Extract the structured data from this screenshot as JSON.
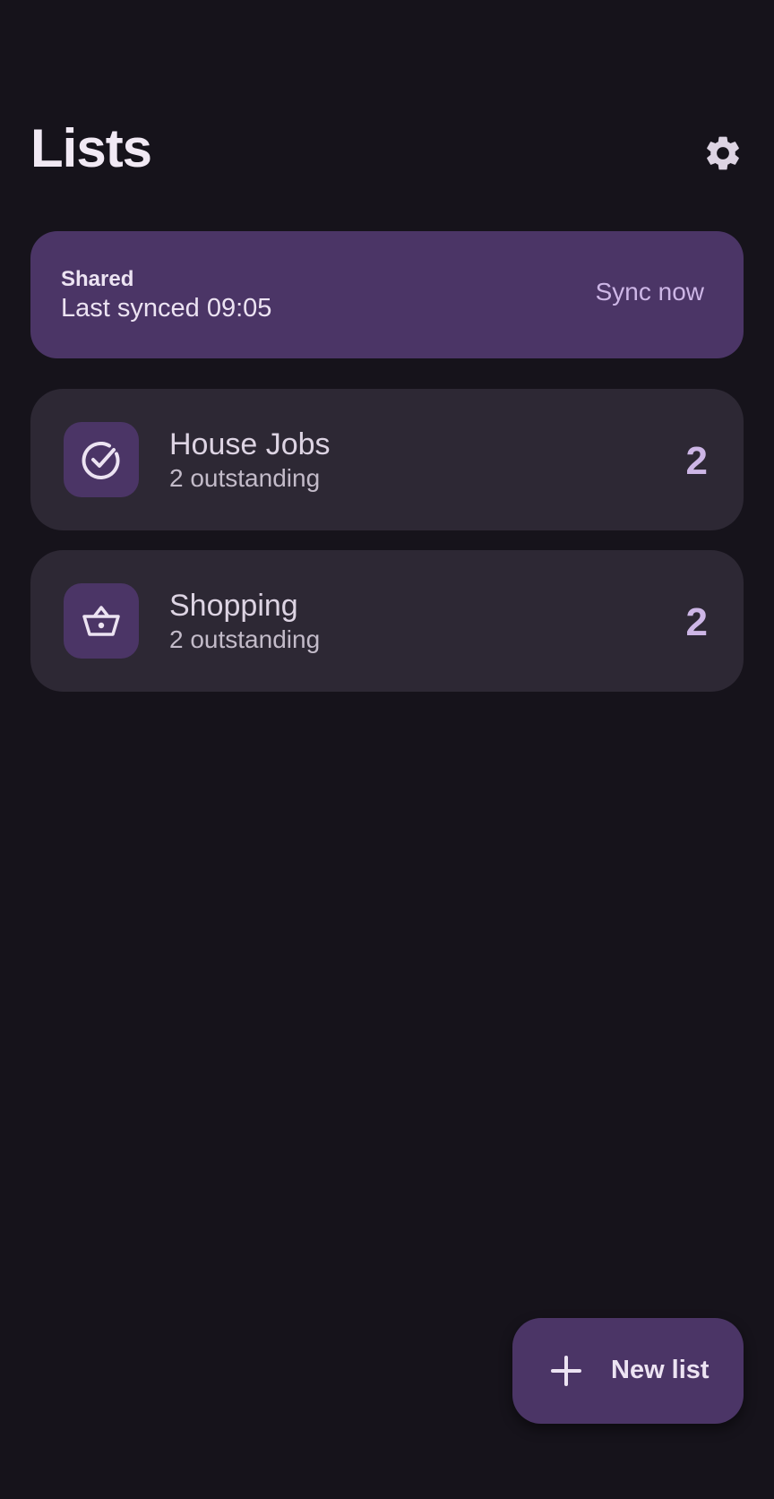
{
  "header": {
    "title": "Lists",
    "settings_icon": "gear-icon"
  },
  "sync": {
    "title": "Shared",
    "status": "Last synced 09:05",
    "action_label": "Sync now"
  },
  "lists": [
    {
      "name": "House Jobs",
      "subtitle": "2 outstanding",
      "count": "2",
      "icon": "check-circle-icon"
    },
    {
      "name": "Shopping",
      "subtitle": "2 outstanding",
      "count": "2",
      "icon": "basket-icon"
    }
  ],
  "fab": {
    "label": "New list",
    "icon": "plus-icon"
  },
  "colors": {
    "background": "#16131b",
    "accent": "#4b3566",
    "card": "#2d2834",
    "accent_text": "#cdb6e6"
  }
}
